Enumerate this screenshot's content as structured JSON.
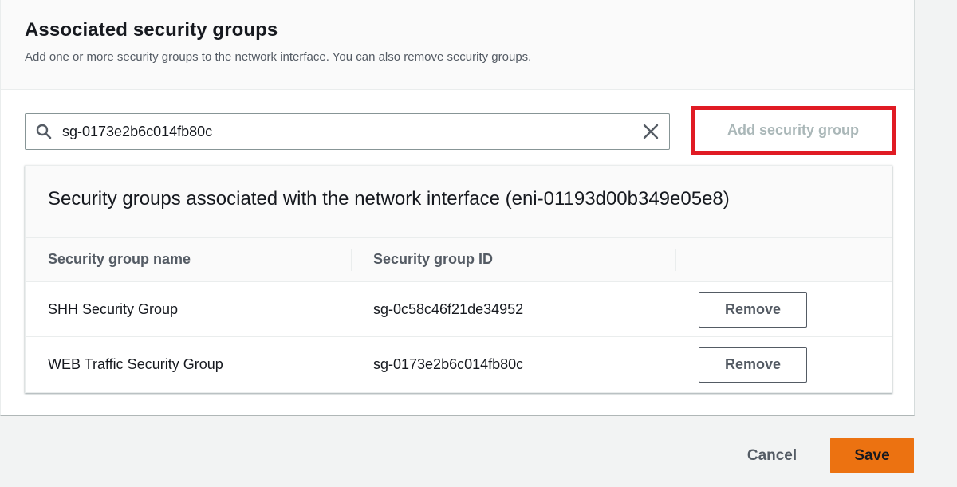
{
  "panel": {
    "title": "Associated security groups",
    "description": "Add one or more security groups to the network interface. You can also remove security groups."
  },
  "search": {
    "value": "sg-0173e2b6c014fb80c",
    "icon": "search-icon",
    "clear_icon": "close-icon"
  },
  "add_button": {
    "label": "Add security group",
    "highlight_color": "#e01b24",
    "disabled": true
  },
  "table": {
    "title": "Security groups associated with the network interface (eni-01193d00b349e05e8)",
    "columns": [
      "Security group name",
      "Security group ID"
    ],
    "rows": [
      {
        "name": "SHH Security Group",
        "id": "sg-0c58c46f21de34952",
        "action": "Remove"
      },
      {
        "name": "WEB Traffic Security Group",
        "id": "sg-0173e2b6c014fb80c",
        "action": "Remove"
      }
    ]
  },
  "footer": {
    "cancel_label": "Cancel",
    "save_label": "Save",
    "save_color": "#ec7211"
  }
}
